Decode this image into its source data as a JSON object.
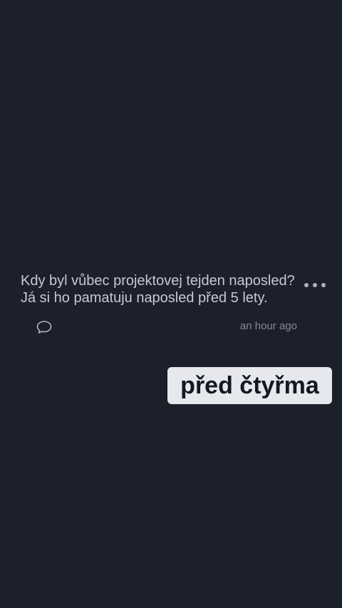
{
  "post": {
    "line1": "Kdy byl vůbec projektovej tejden naposled?",
    "line2": "Já si ho pamatuju naposled před 5 lety.",
    "timestamp": "an hour ago",
    "more_icon": "more-horizontal-icon",
    "comment_icon": "comment-bubble-icon"
  },
  "sticker": {
    "text": "před čtyřma"
  },
  "colors": {
    "background": "#1b202b",
    "post_text": "#c5c9d1",
    "muted_text": "#858a94",
    "sticker_bg": "#e6e8ed",
    "sticker_text": "#14181f"
  }
}
